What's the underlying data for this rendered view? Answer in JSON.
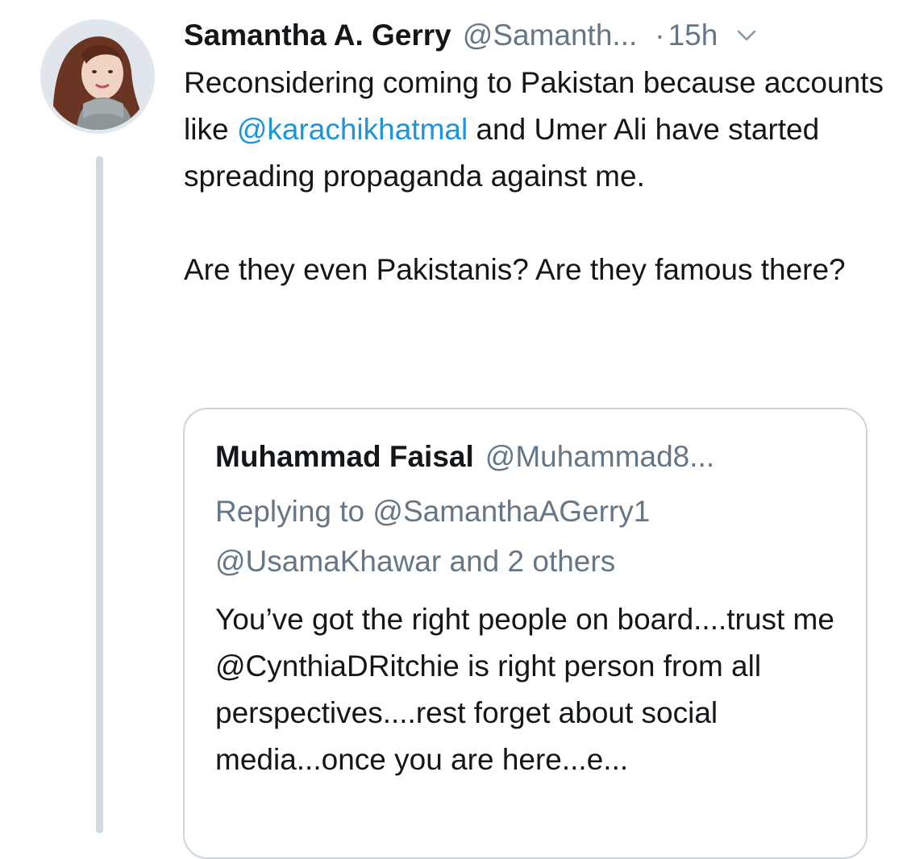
{
  "tweet": {
    "author_name": "Samantha A. Gerry",
    "author_handle": "@Samanth...",
    "separator": "·",
    "time": "15h",
    "text_line1_prefix": "Reconsidering coming to Pakistan because accounts like ",
    "mention_1": "@karachikhatmal",
    "text_line1_suffix": " and Umer Ali have started spreading propaganda against me.",
    "text_paragraph2": "Are they even Pakistanis? Are they famous there?",
    "icons": {
      "avatar": "profile-photo",
      "menu": "chevron-down-icon"
    }
  },
  "quote": {
    "author_name": "Muhammad Faisal",
    "author_handle": "@Muhammad8...",
    "replying_prefix": "Replying to ",
    "replying_to_1": "@SamanthaAGerry1",
    "replying_to_2": "@UsamaKhawar",
    "replying_suffix": " and 2 others",
    "text": "You’ve got the right people on board....trust me @CynthiaDRitchie is right person from all perspectives....rest forget about social media...once you are here...e..."
  },
  "colors": {
    "text_primary": "#14171a",
    "text_secondary": "#657786",
    "link": "#1b95e0",
    "border": "#ccd6dd",
    "thread_line": "#cfd9de"
  }
}
